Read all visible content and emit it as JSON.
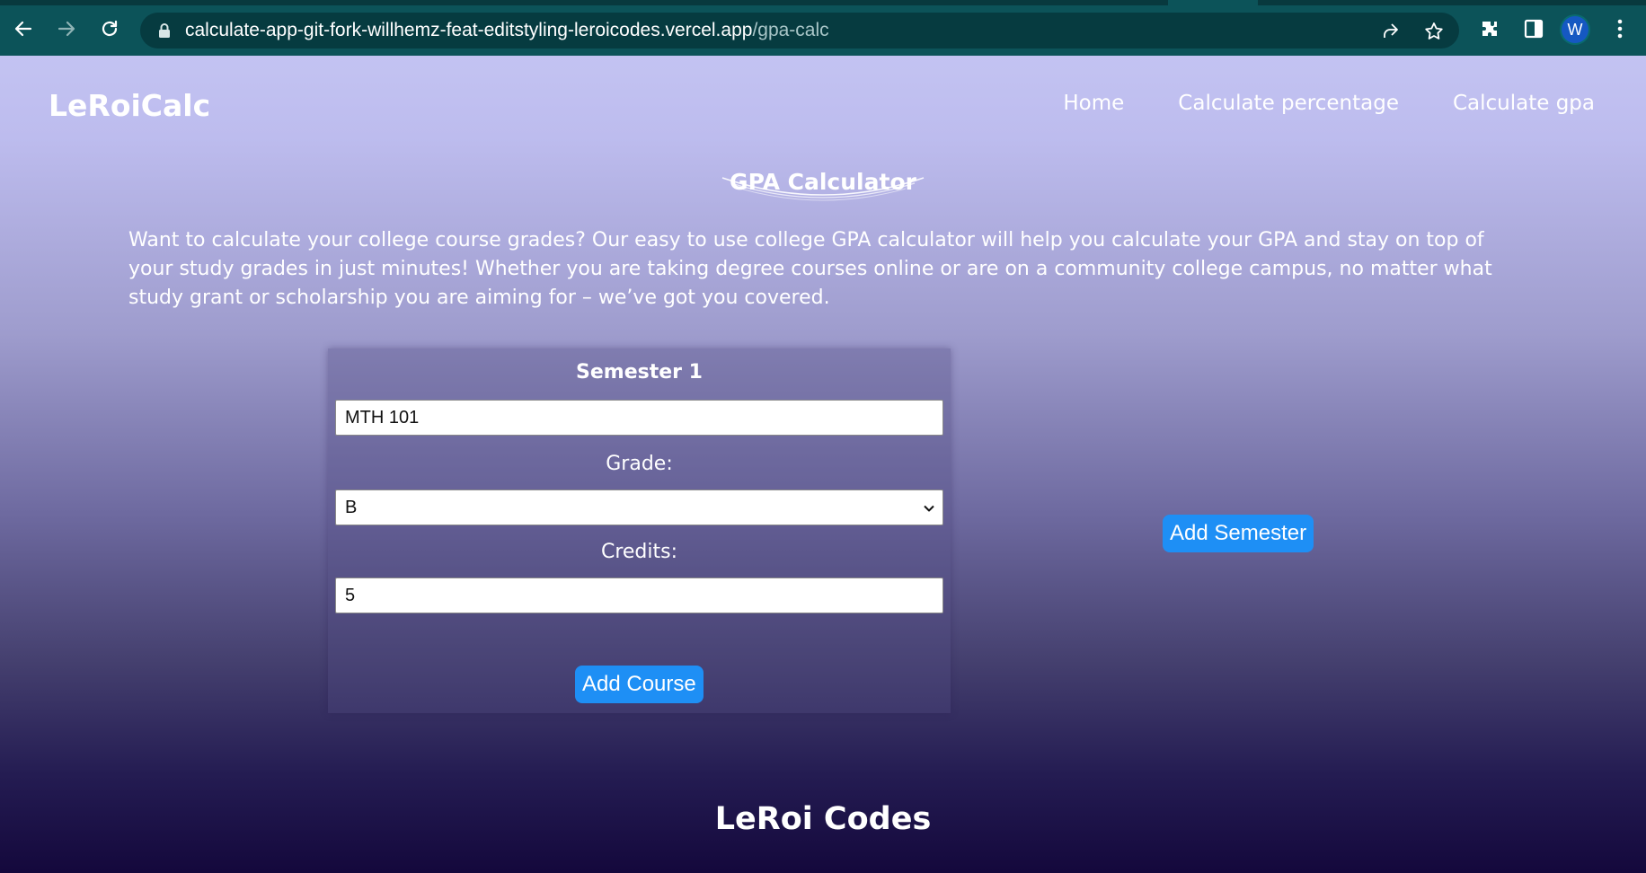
{
  "browser": {
    "url_host": "calculate-app-git-fork-willhemz-feat-editstyling-leroicodes.vercel.app",
    "url_path": "/gpa-calc",
    "profile_initial": "W",
    "icons": [
      "back-arrow-icon",
      "forward-arrow-icon",
      "reload-icon",
      "lock-icon",
      "share-icon",
      "star-icon",
      "extensions-icon",
      "side-panel-icon",
      "menu-dots-icon"
    ]
  },
  "nav": {
    "brand": "LeRoiCalc",
    "links": [
      "Home",
      "Calculate percentage",
      "Calculate gpa"
    ]
  },
  "main": {
    "title": "GPA Calculator",
    "intro": "Want to calculate your college course grades? Our easy to use college GPA calculator will help you calculate your GPA and stay on top of your study grades in just minutes! Whether you are taking degree courses online or are on a community college campus, no matter what study grant or scholarship you are aiming for – we’ve got you covered."
  },
  "semester": {
    "title": "Semester 1",
    "course_value": "MTH 101",
    "grade_label": "Grade:",
    "grade_value": "B",
    "credits_label": "Credits:",
    "credits_value": "5",
    "add_course_label": "Add Course"
  },
  "add_semester_label": "Add Semester",
  "footer": {
    "title": "LeRoi Codes"
  },
  "colors": {
    "chrome": "#0c5359",
    "omnibox": "#063b40",
    "button": "#1e8ff5",
    "gradient_top": "#c3c3f2",
    "gradient_bottom": "#14083c"
  }
}
